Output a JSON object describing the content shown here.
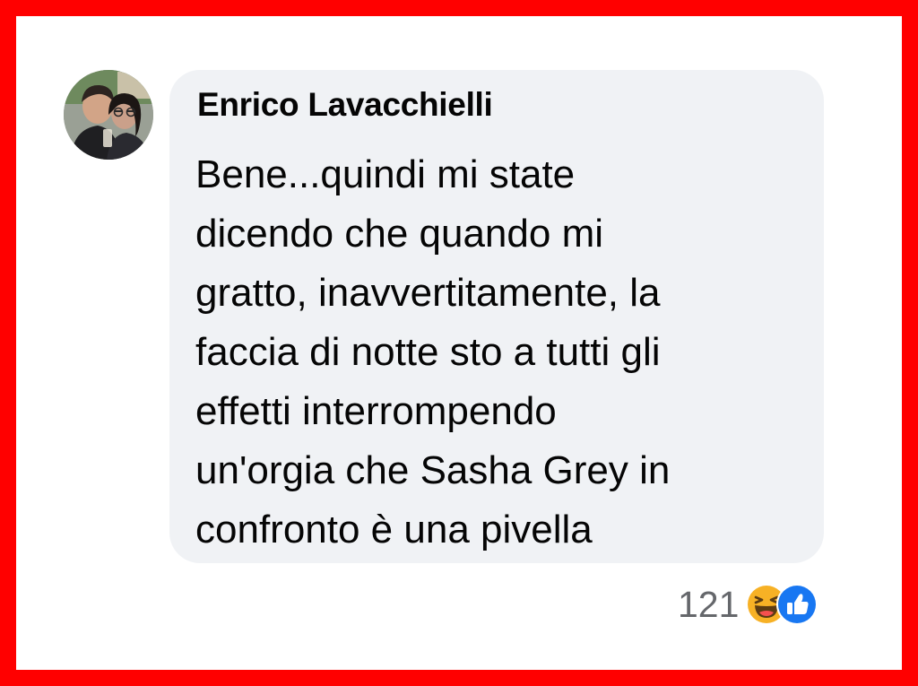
{
  "comment": {
    "author": "Enrico Lavacchielli",
    "text_lines": [
      "Bene...quindi mi state",
      "dicendo che quando mi",
      "gratto, inavvertitamente, la",
      "faccia di notte sto a tutti gli",
      "effetti interrompendo",
      "un'orgia che Sasha Grey in",
      "confronto è una pivella"
    ],
    "reactions": {
      "count": "121",
      "icons": [
        "laugh-reaction-icon",
        "like-reaction-icon"
      ]
    }
  },
  "colors": {
    "frame_border": "#ff0000",
    "bubble_background": "#f0f2f5",
    "text": "#050505",
    "secondary_text": "#65676b",
    "like_blue": "#1877f2",
    "haha_yellow": "#f7b125"
  }
}
